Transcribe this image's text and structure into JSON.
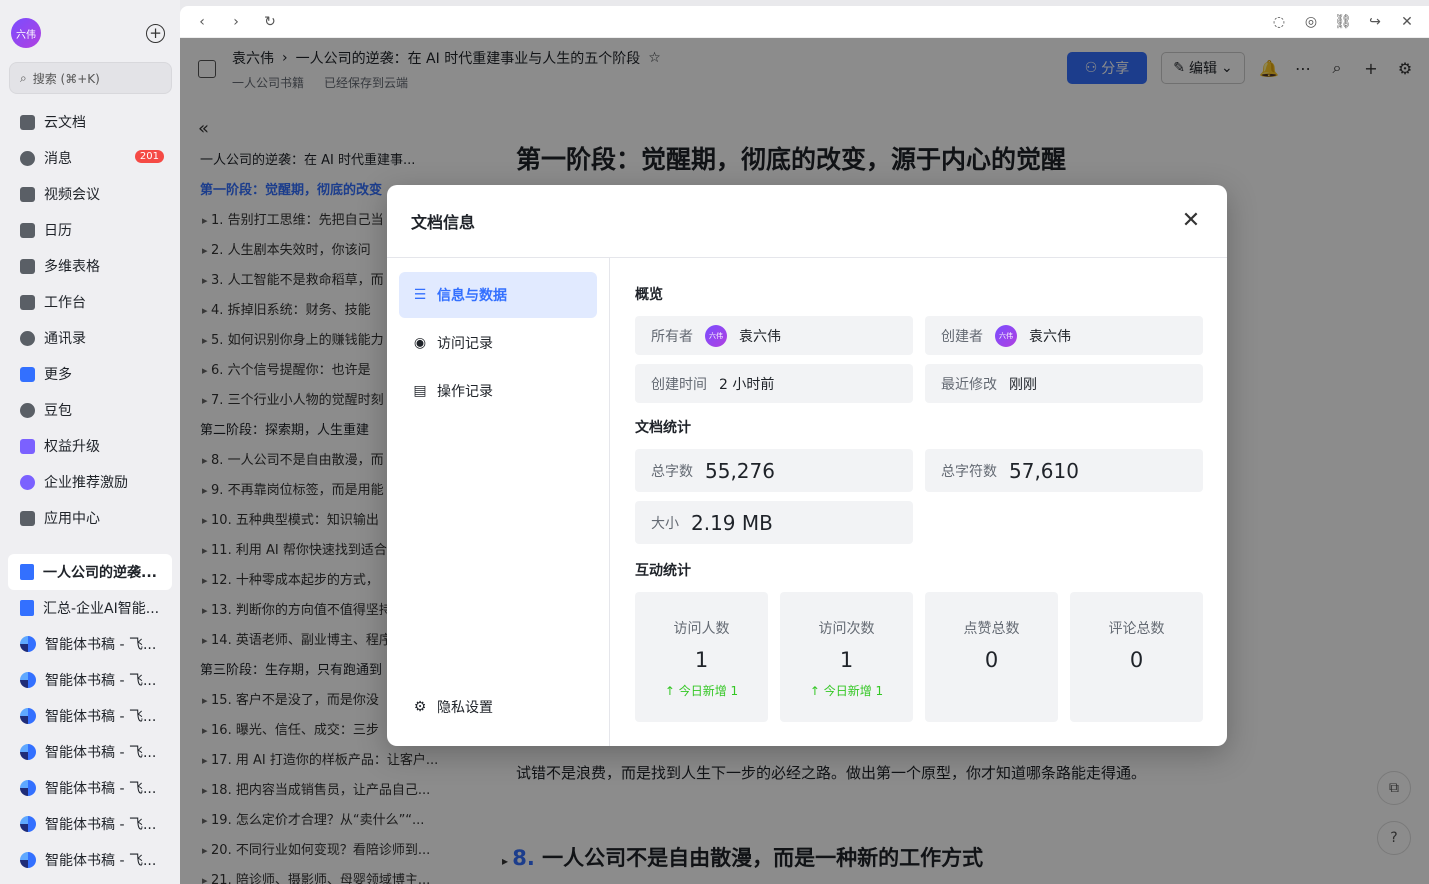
{
  "sidebar": {
    "avatar_text": "六伟",
    "search_placeholder": "搜索 (⌘+K)",
    "nav": [
      {
        "label": "云文档"
      },
      {
        "label": "消息",
        "badge": "201"
      },
      {
        "label": "视频会议"
      },
      {
        "label": "日历"
      },
      {
        "label": "多维表格"
      },
      {
        "label": "工作台"
      },
      {
        "label": "通讯录"
      },
      {
        "label": "更多"
      },
      {
        "label": "豆包"
      },
      {
        "label": "权益升级"
      },
      {
        "label": "企业推荐激励"
      },
      {
        "label": "应用中心"
      }
    ],
    "docs": [
      {
        "label": "一人公司的逆袭..."
      },
      {
        "label": "汇总-企业AI智能..."
      },
      {
        "label": "智能体书稿 - 飞..."
      },
      {
        "label": "智能体书稿 - 飞..."
      },
      {
        "label": "智能体书稿 - 飞..."
      },
      {
        "label": "智能体书稿 - 飞..."
      },
      {
        "label": "智能体书稿 - 飞..."
      },
      {
        "label": "智能体书稿 - 飞..."
      },
      {
        "label": "智能体书稿 - 飞..."
      }
    ]
  },
  "header": {
    "crumb_owner": "袁六伟",
    "doc_title": "一人公司的逆袭：在 AI 时代重建事业与人生的五个阶段",
    "folder": "一人公司书籍",
    "save_status": "已经保存到云端",
    "share_label": "分享",
    "edit_label": "编辑"
  },
  "outline": {
    "items": [
      {
        "text": "一人公司的逆袭：在 AI 时代重建事..."
      },
      {
        "text": "第一阶段：觉醒期，彻底的改变"
      },
      {
        "text": "1. 告别打工思维：先把自己当"
      },
      {
        "text": "2. 人生剧本失效时，你该问"
      },
      {
        "text": "3. 人工智能不是救命稻草，而"
      },
      {
        "text": "4. 拆掉旧系统：财务、技能"
      },
      {
        "text": "5. 如何识别你身上的赚钱能力"
      },
      {
        "text": "6. 六个信号提醒你：也许是"
      },
      {
        "text": "7. 三个行业小人物的觉醒时刻"
      },
      {
        "text": "第二阶段：探索期，人生重建"
      },
      {
        "text": "8. 一人公司不是自由散漫，而"
      },
      {
        "text": "9. 不再靠岗位标签，而是用能"
      },
      {
        "text": "10. 五种典型模式：知识输出"
      },
      {
        "text": "11. 利用 AI 帮你快速找到适合"
      },
      {
        "text": "12. 十种零成本起步的方式，"
      },
      {
        "text": "13. 判断你的方向值不值得坚持"
      },
      {
        "text": "14. 英语老师、副业博主、程序"
      },
      {
        "text": "第三阶段：生存期，只有跑通到"
      },
      {
        "text": "15. 客户不是没了，而是你没"
      },
      {
        "text": "16. 曝光、信任、成交：三步"
      },
      {
        "text": "17. 用 AI 打造你的样板产品：让客户..."
      },
      {
        "text": "18. 把内容当成销售员，让产品自己..."
      },
      {
        "text": "19. 怎么定价才合理？从“卖什么”“..."
      },
      {
        "text": "20. 不同行业如何变现？看陪诊师到..."
      },
      {
        "text": "21. 陪诊师、摄影师、母婴领域博主..."
      }
    ]
  },
  "content": {
    "heading": "第一阶段：觉醒期，彻底的改变，源于内心的觉醒",
    "paragraph": "试错不是浪费，而是找到人生下一步的必经之路。做出第一个原型，你才知道哪条路能走得通。",
    "h2_num": "8.",
    "h2_text": "一人公司不是自由散漫，而是一种新的工作方式"
  },
  "modal": {
    "title": "文档信息",
    "tabs": [
      {
        "label": "信息与数据"
      },
      {
        "label": "访问记录"
      },
      {
        "label": "操作记录"
      }
    ],
    "privacy_label": "隐私设置",
    "overview_title": "概览",
    "owner_label": "所有者",
    "owner_name": "袁六伟",
    "creator_label": "创建者",
    "creator_name": "袁六伟",
    "mini_avatar": "六伟",
    "created_label": "创建时间",
    "created_value": "2 小时前",
    "modified_label": "最近修改",
    "modified_value": "刚刚",
    "stats_title": "文档统计",
    "words_label": "总字数",
    "words_value": "55,276",
    "chars_label": "总字符数",
    "chars_value": "57,610",
    "size_label": "大小",
    "size_value": "2.19 MB",
    "interaction_title": "互动统计",
    "interactions": [
      {
        "label": "访问人数",
        "value": "1",
        "inc": "↑ 今日新增 1"
      },
      {
        "label": "访问次数",
        "value": "1",
        "inc": "↑ 今日新增 1"
      },
      {
        "label": "点赞总数",
        "value": "0",
        "inc": ""
      },
      {
        "label": "评论总数",
        "value": "0",
        "inc": ""
      }
    ]
  }
}
